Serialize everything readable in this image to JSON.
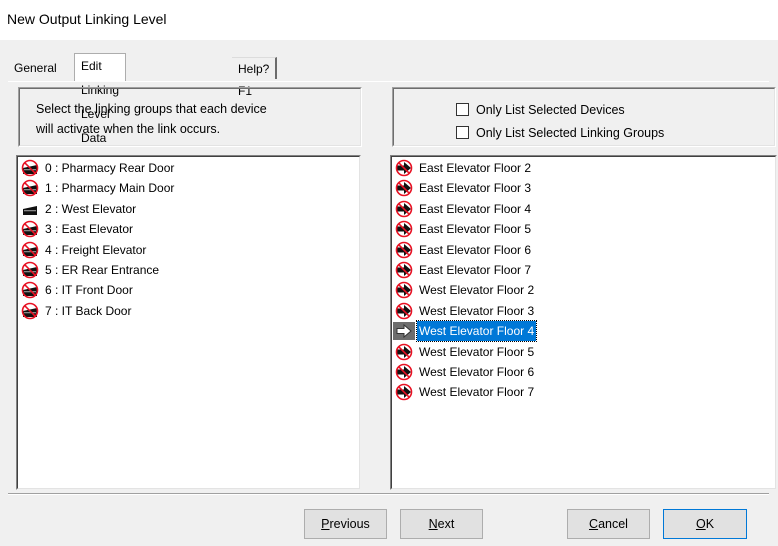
{
  "window": {
    "title": "New Output Linking Level"
  },
  "tabs": [
    {
      "label": "General"
    },
    {
      "label": "Edit Linking Level Data"
    },
    {
      "label": "Help? F1"
    }
  ],
  "instructions": {
    "line1": "Select the linking groups that each device",
    "line2": "will activate when the link occurs."
  },
  "options": {
    "only_selected_devices": {
      "label": "Only List Selected Devices",
      "checked": false
    },
    "only_selected_groups": {
      "label": "Only List Selected Linking Groups",
      "checked": false
    }
  },
  "devices": [
    {
      "label": "0 : Pharmacy Rear Door",
      "icon": "door-disabled-icon",
      "state": "off"
    },
    {
      "label": "1 : Pharmacy Main Door",
      "icon": "door-disabled-icon",
      "state": "off"
    },
    {
      "label": "2 : West Elevator",
      "icon": "door-icon",
      "state": "on"
    },
    {
      "label": "3 : East Elevator",
      "icon": "door-disabled-icon",
      "state": "off"
    },
    {
      "label": "4 : Freight Elevator",
      "icon": "door-disabled-icon",
      "state": "off"
    },
    {
      "label": "5 : ER Rear Entrance",
      "icon": "door-disabled-icon",
      "state": "off"
    },
    {
      "label": "6 : IT Front Door",
      "icon": "door-disabled-icon",
      "state": "off"
    },
    {
      "label": "7 : IT  Back Door",
      "icon": "door-disabled-icon",
      "state": "off"
    }
  ],
  "linking_groups": [
    {
      "label": "East Elevator Floor 2",
      "icon": "arrow-disabled-icon",
      "selected": false
    },
    {
      "label": "East Elevator Floor 3",
      "icon": "arrow-disabled-icon",
      "selected": false
    },
    {
      "label": "East Elevator Floor 4",
      "icon": "arrow-disabled-icon",
      "selected": false
    },
    {
      "label": "East Elevator Floor 5",
      "icon": "arrow-disabled-icon",
      "selected": false
    },
    {
      "label": "East Elevator Floor 6",
      "icon": "arrow-disabled-icon",
      "selected": false
    },
    {
      "label": "East Elevator Floor 7",
      "icon": "arrow-disabled-icon",
      "selected": false
    },
    {
      "label": "West Elevator Floor 2",
      "icon": "arrow-disabled-icon",
      "selected": false
    },
    {
      "label": "West Elevator Floor 3",
      "icon": "arrow-disabled-icon",
      "selected": false
    },
    {
      "label": "West Elevator Floor 4",
      "icon": "arrow-outline-icon",
      "selected": true
    },
    {
      "label": "West Elevator Floor 5",
      "icon": "arrow-disabled-icon",
      "selected": false
    },
    {
      "label": "West Elevator Floor 6",
      "icon": "arrow-disabled-icon",
      "selected": false
    },
    {
      "label": "West Elevator Floor 7",
      "icon": "arrow-disabled-icon",
      "selected": false
    }
  ],
  "buttons": {
    "previous": {
      "prefix": "",
      "accel": "P",
      "rest": "revious"
    },
    "next": {
      "prefix": "",
      "accel": "N",
      "rest": "ext"
    },
    "cancel": {
      "prefix": "",
      "accel": "C",
      "rest": "ancel"
    },
    "ok": {
      "prefix": "",
      "accel": "O",
      "rest": "K"
    }
  },
  "colors": {
    "selection": "#0078d7",
    "no_sign": "#e81123",
    "window_bg": "#f0f0f0"
  }
}
